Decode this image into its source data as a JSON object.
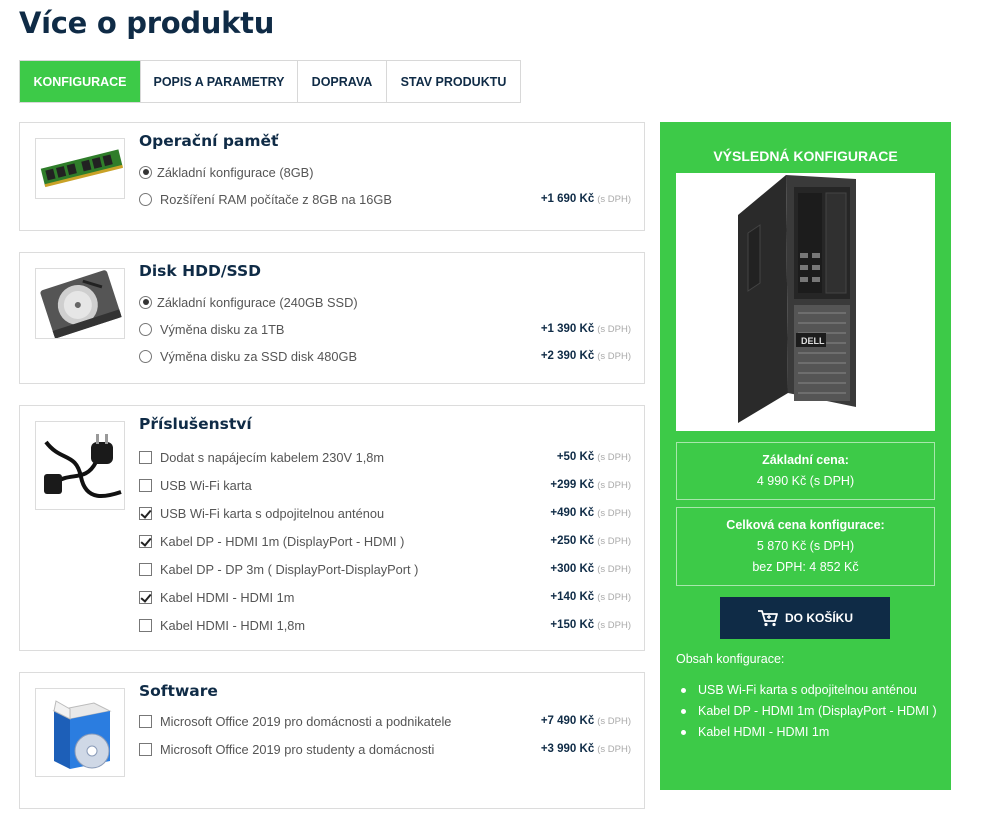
{
  "page_title": "Více o produktu",
  "tabs": [
    {
      "label": "KONFIGURACE",
      "active": true
    },
    {
      "label": "POPIS A PARAMETRY",
      "active": false
    },
    {
      "label": "DOPRAVA",
      "active": false
    },
    {
      "label": "STAV PRODUKTU",
      "active": false
    }
  ],
  "vat_suffix": "(s DPH)",
  "sections": [
    {
      "title": "Operační paměť",
      "image_icon": "ram-module-icon",
      "type": "radio",
      "options": [
        {
          "label": "Základní konfigurace (8GB)",
          "price": "",
          "selected": true
        },
        {
          "label": "Rozšíření RAM počítače z 8GB na 16GB",
          "price": "+1 690 Kč",
          "selected": false
        }
      ]
    },
    {
      "title": "Disk HDD/SSD",
      "image_icon": "hard-disk-icon",
      "type": "radio",
      "options": [
        {
          "label": "Základní konfigurace (240GB SSD)",
          "price": "",
          "selected": true
        },
        {
          "label": "Výměna disku za 1TB",
          "price": "+1 390 Kč",
          "selected": false
        },
        {
          "label": "Výměna disku za SSD disk 480GB",
          "price": "+2 390 Kč",
          "selected": false
        }
      ]
    },
    {
      "title": "Příslušenství",
      "image_icon": "power-cable-icon",
      "type": "checkbox",
      "options": [
        {
          "label": "Dodat s napájecím kabelem 230V 1,8m",
          "price": "+50 Kč",
          "selected": false
        },
        {
          "label": "USB Wi-Fi karta",
          "price": "+299 Kč",
          "selected": false
        },
        {
          "label": "USB Wi-Fi karta s odpojitelnou anténou",
          "price": "+490 Kč",
          "selected": true
        },
        {
          "label": "Kabel DP - HDMI 1m (DisplayPort - HDMI )",
          "price": "+250 Kč",
          "selected": true
        },
        {
          "label": "Kabel DP - DP 3m ( DisplayPort-DisplayPort )",
          "price": "+300 Kč",
          "selected": false
        },
        {
          "label": "Kabel HDMI - HDMI 1m",
          "price": "+140 Kč",
          "selected": true
        },
        {
          "label": "Kabel HDMI - HDMI 1,8m",
          "price": "+150 Kč",
          "selected": false
        }
      ]
    },
    {
      "title": "Software",
      "image_icon": "software-box-icon",
      "type": "checkbox",
      "options": [
        {
          "label": "Microsoft Office 2019 pro domácnosti a podnikatele",
          "price": "+7 490 Kč",
          "selected": false
        },
        {
          "label": "Microsoft Office 2019 pro studenty a domácnosti",
          "price": "+3 990 Kč",
          "selected": false
        }
      ]
    }
  ],
  "summary": {
    "title": "VÝSLEDNÁ KONFIGURACE",
    "product_image": "desktop-pc-tower",
    "brand_mark": "DELL",
    "base_price_label": "Základní cena:",
    "base_price": "4 990 Kč (s DPH)",
    "total_label": "Celková cena konfigurace:",
    "total_price": "5 870 Kč (s DPH)",
    "total_without_vat": "bez DPH: 4 852 Kč",
    "cart_button": "DO KOŠÍKU",
    "contents_label": "Obsah konfigurace:",
    "contents": [
      "USB Wi-Fi karta s odpojitelnou anténou",
      "Kabel DP - HDMI 1m (DisplayPort - HDMI )",
      "Kabel HDMI - HDMI 1m"
    ]
  },
  "colors": {
    "accent_green": "#3dca48",
    "navy": "#0f2b46",
    "border": "#dcdcdc"
  }
}
